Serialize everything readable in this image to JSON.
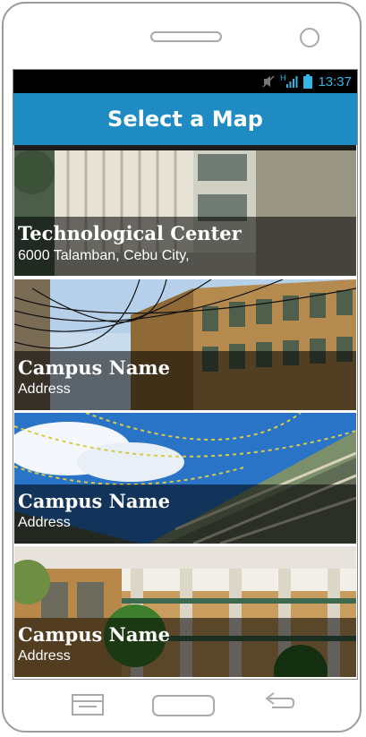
{
  "status": {
    "time": "13:37",
    "network": "H"
  },
  "header": {
    "title": "Select a Map"
  },
  "campuses": [
    {
      "name": "Technological Center",
      "address": "6000 Talamban, Cebu City,"
    },
    {
      "name": "Campus Name",
      "address": "Address"
    },
    {
      "name": "Campus Name",
      "address": "Address"
    },
    {
      "name": "Campus Name",
      "address": "Address"
    }
  ],
  "icons": {
    "mute": "mute-icon",
    "signal": "signal-icon",
    "battery": "battery-icon",
    "menu": "menu-icon",
    "home": "home-icon",
    "back": "back-icon"
  },
  "colors": {
    "accent": "#1e8bc3",
    "status_text": "#33b5e5"
  }
}
